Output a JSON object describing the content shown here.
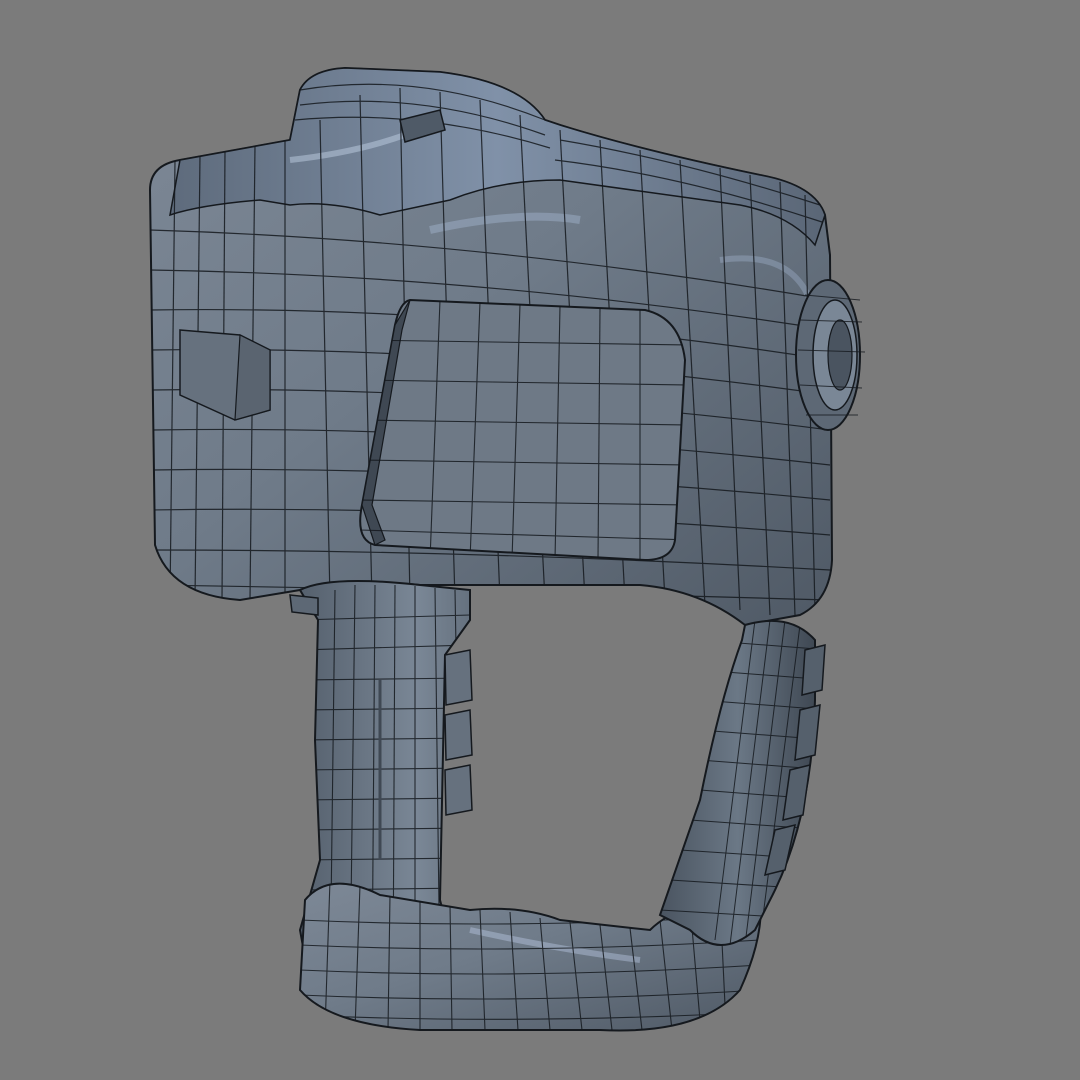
{
  "scene": {
    "background_color": "#7b7b7b",
    "subject": "wireframe-3d-model",
    "model": {
      "shading_color": "#6f7b89",
      "shadow_color": "#3f4853",
      "highlight_color": "#b9c7dc",
      "wire_color": "#15191e",
      "display_mode": "shaded-with-wireframe"
    }
  }
}
